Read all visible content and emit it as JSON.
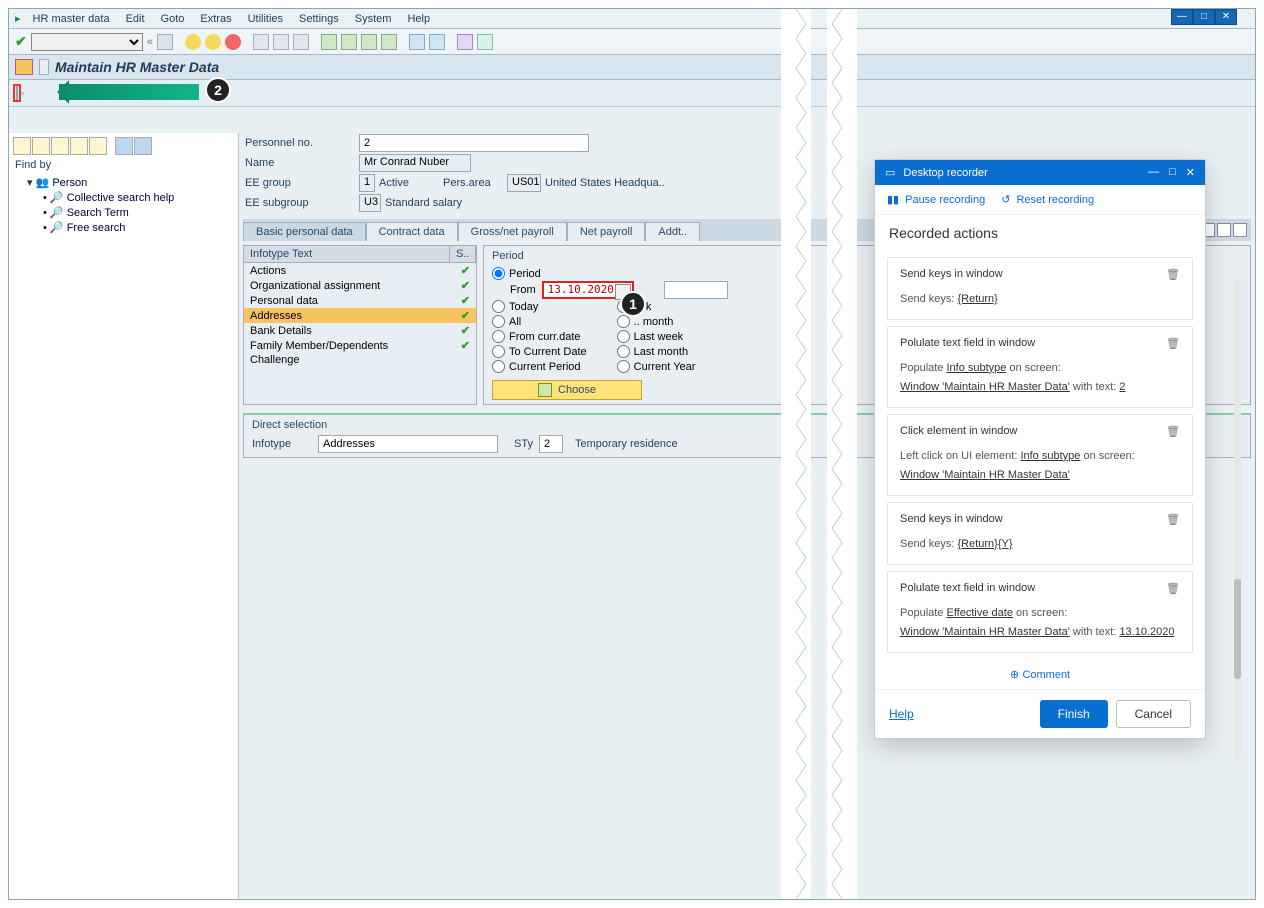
{
  "menu": [
    "HR master data",
    "Edit",
    "Goto",
    "Extras",
    "Utilities",
    "Settings",
    "System",
    "Help"
  ],
  "title": "Maintain HR Master Data",
  "findby": "Find by",
  "tree": {
    "root": "Person",
    "leaves": [
      "Collective search help",
      "Search Term",
      "Free search"
    ]
  },
  "person": {
    "personno_lbl": "Personnel no.",
    "personno": "2",
    "name_lbl": "Name",
    "name": "Mr Conrad Nuber",
    "eegrp_lbl": "EE group",
    "eegrp": "1",
    "eegrp_txt": "Active",
    "persarea_lbl": "Pers.area",
    "persarea": "US01",
    "persarea_txt": "United States Headqua..",
    "eesub_lbl": "EE subgroup",
    "eesub": "U3",
    "eesub_txt": "Standard salary"
  },
  "tabs": [
    "Basic personal data",
    "Contract data",
    "Gross/net payroll",
    "Net payroll",
    "Addt.."
  ],
  "list": {
    "h1": "Infotype Text",
    "h2": "S..",
    "rows": [
      "Actions",
      "Organizational assignment",
      "Personal data",
      "Addresses",
      "Bank Details",
      "Family Member/Dependents",
      "Challenge"
    ]
  },
  "period": {
    "title": "Period",
    "r0": "Period",
    "from": "From",
    "date": "13.10.2020",
    "r1": "Today",
    "r2": "All",
    "r3": "From curr.date",
    "r4": "To Current Date",
    "r5": "Current Period",
    "c1": "..ek",
    "c2": ".. month",
    "c3": "Last week",
    "c4": "Last month",
    "c5": "Current Year",
    "choose": "Choose"
  },
  "ds": {
    "title": "Direct selection",
    "infotype_lbl": "Infotype",
    "infotype": "Addresses",
    "sty_lbl": "STy",
    "sty": "2",
    "sty_txt": "Temporary residence"
  },
  "rec": {
    "title": "Desktop recorder",
    "pause": "Pause recording",
    "reset": "Reset recording",
    "heading": "Recorded actions",
    "cards": [
      {
        "t": "Send keys in window",
        "l1a": "Send keys: ",
        "l1b": "{Return}"
      },
      {
        "t": "Polulate text field in window",
        "l1a": "Populate ",
        "l1b": "Info subtype",
        "l1c": " on screen:",
        "l2a": "Window 'Maintain HR Master Data'",
        "l2b": " with text: ",
        "l2c": "2"
      },
      {
        "t": "Click element in window",
        "l1a": "Left click on UI element: ",
        "l1b": "Info subtype",
        "l1c": " on screen:",
        "l2a": "Window 'Maintain HR Master Data'"
      },
      {
        "t": "Send keys in window",
        "l1a": "Send keys: ",
        "l1b": "{Return}{Y}"
      },
      {
        "t": "Polulate text field in window",
        "l1a": "Populate ",
        "l1b": "Effective date",
        "l1c": " on screen:",
        "l2a": "Window 'Maintain HR Master Data'",
        "l2b": " with text: ",
        "l2c": "13.10.2020"
      }
    ],
    "comment": "Comment",
    "help": "Help",
    "finish": "Finish",
    "cancel": "Cancel"
  },
  "badges": {
    "one": "1",
    "two": "2"
  }
}
